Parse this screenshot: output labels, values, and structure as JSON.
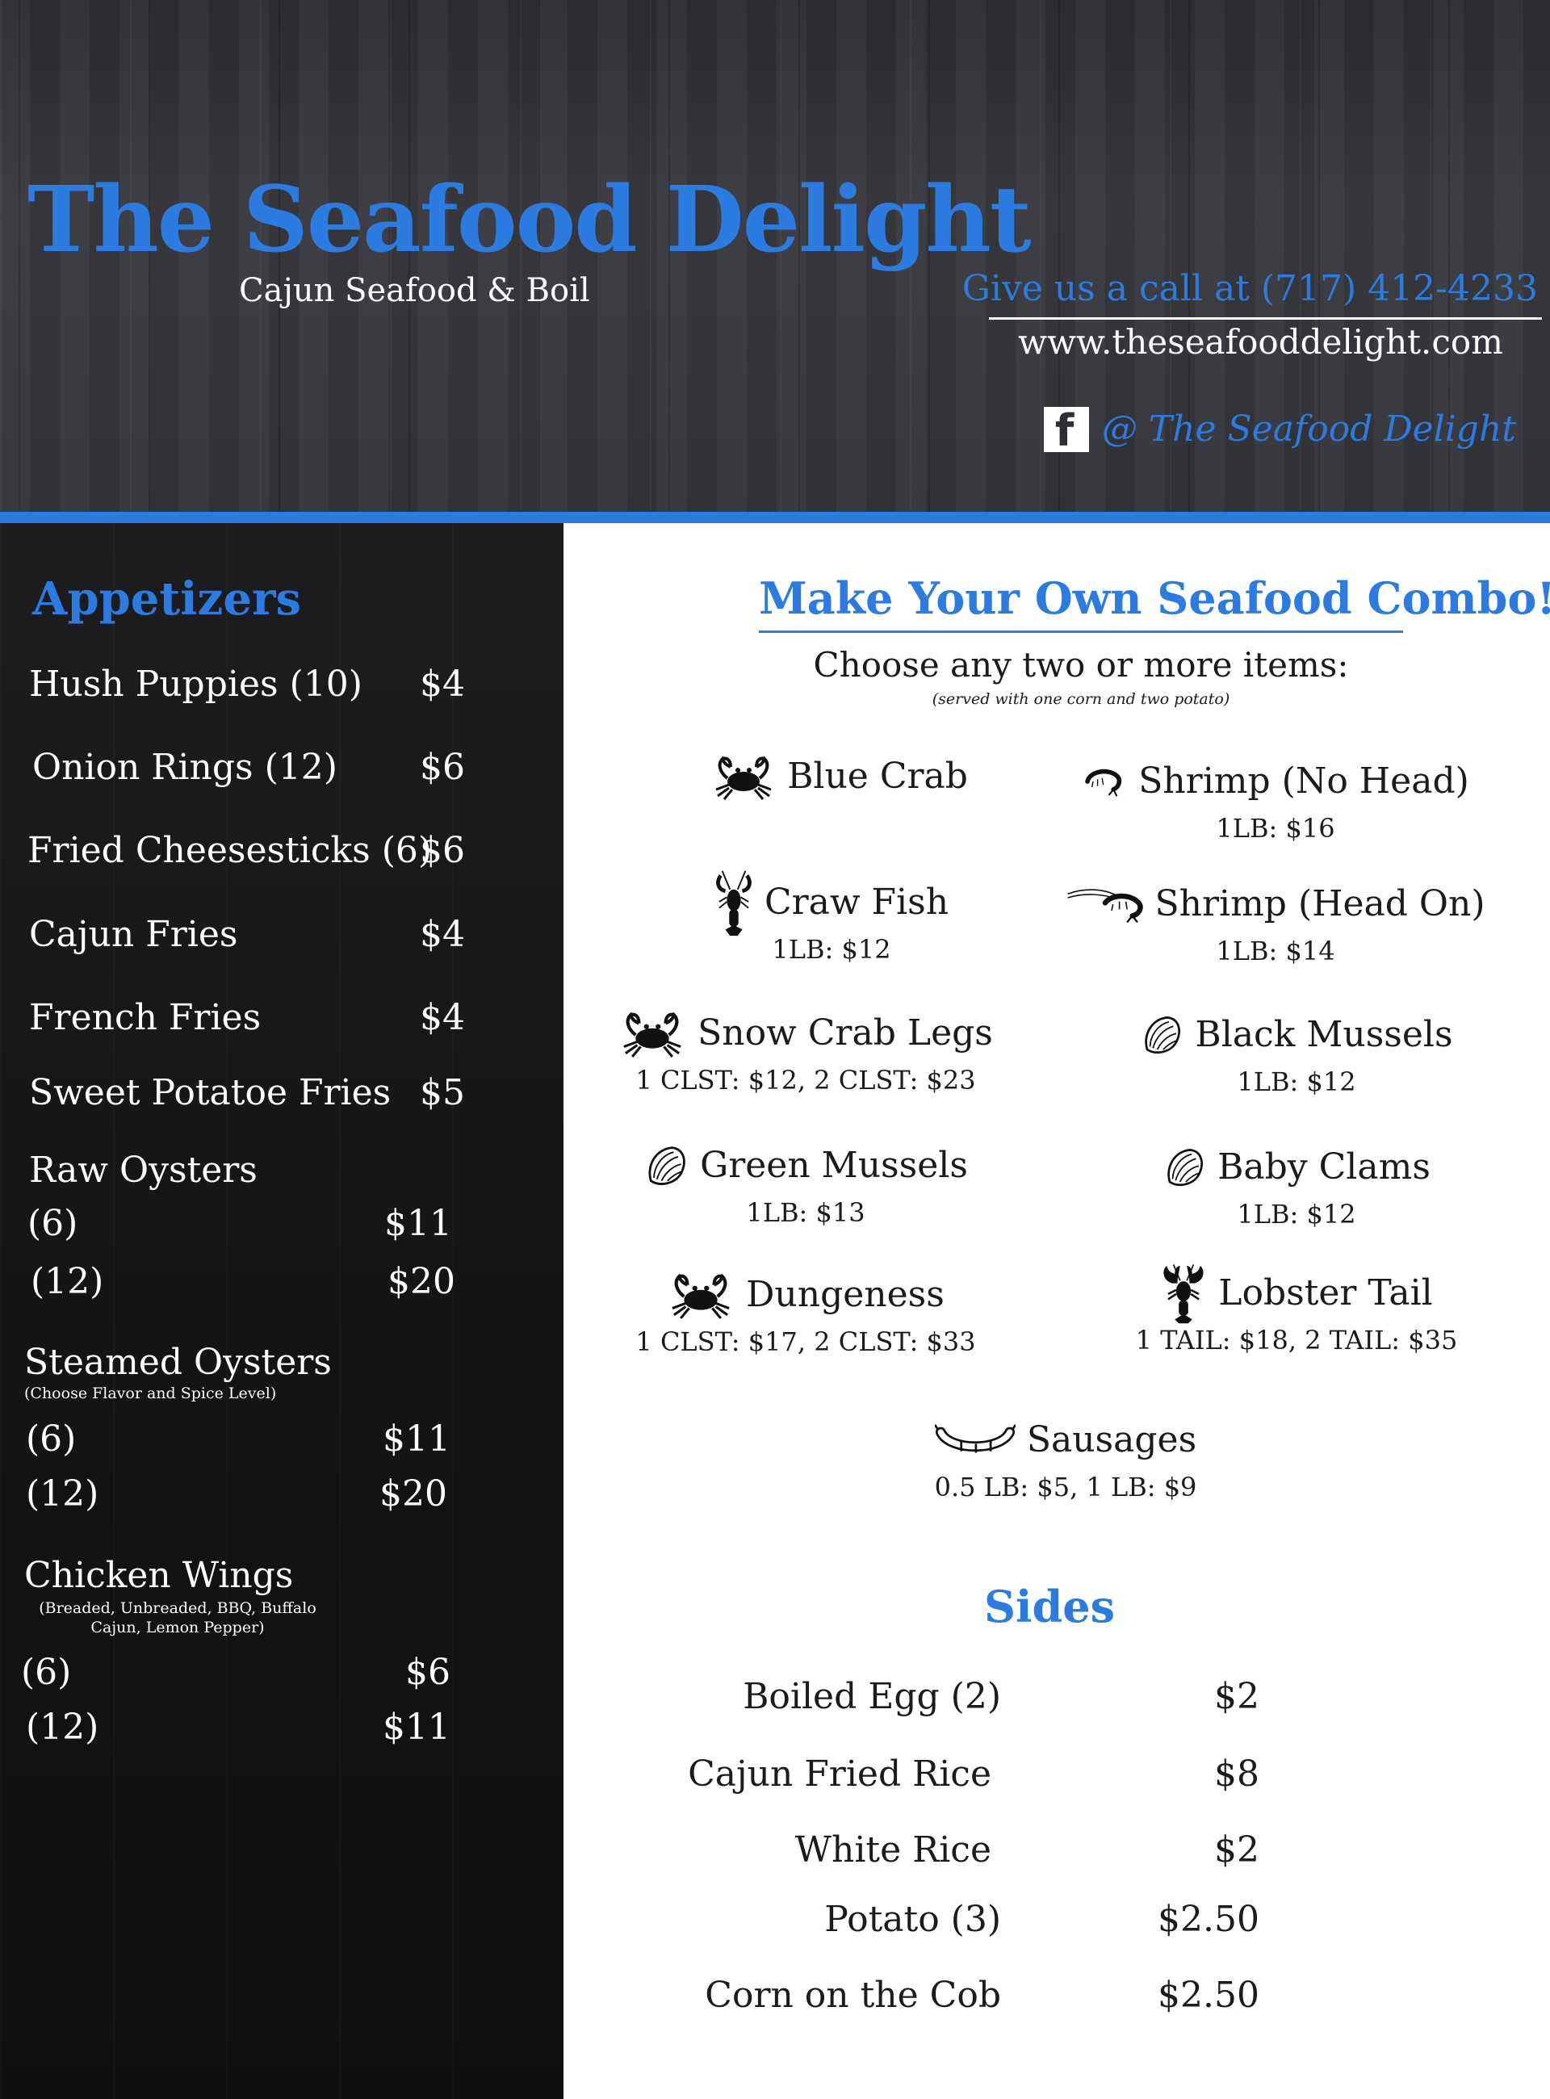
{
  "header": {
    "title": "The Seafood Delight",
    "subtitle": "Cajun Seafood & Boil",
    "phone_line": "Give us a call at (717) 412-4233",
    "website": "www.theseafooddelight.com",
    "facebook_letter": "f",
    "facebook_handle": "@ The Seafood Delight"
  },
  "appetizers": {
    "title": "Appetizers",
    "items": [
      {
        "name": "Hush Puppies (10)",
        "price": "$4"
      },
      {
        "name": "Onion Rings (12)",
        "price": "$6"
      },
      {
        "name": "Fried Cheesesticks (6)",
        "price": "$6"
      },
      {
        "name": "Cajun Fries",
        "price": "$4"
      },
      {
        "name": "French Fries",
        "price": "$4"
      },
      {
        "name": "Sweet Potatoe Fries",
        "price": "$5"
      }
    ],
    "raw_oysters": {
      "title": "Raw Oysters",
      "options": [
        {
          "qty": "(6)",
          "price": "$11"
        },
        {
          "qty": "(12)",
          "price": "$20"
        }
      ]
    },
    "steamed_oysters": {
      "title": "Steamed Oysters",
      "note": "(Choose Flavor and Spice Level)",
      "options": [
        {
          "qty": "(6)",
          "price": "$11"
        },
        {
          "qty": "(12)",
          "price": "$20"
        }
      ]
    },
    "chicken_wings": {
      "title": "Chicken Wings",
      "note": "(Breaded, Unbreaded, BBQ, Buffalo Cajun, Lemon Pepper)",
      "options": [
        {
          "qty": "(6)",
          "price": "$6"
        },
        {
          "qty": "(12)",
          "price": "$11"
        }
      ]
    }
  },
  "combo": {
    "title": "Make Your Own Seafood Combo!",
    "subtitle": "Choose any two or more items:",
    "note": "(served with one corn and two potato)",
    "items": [
      {
        "name": "Blue Crab",
        "price": "",
        "icon": "crab-icon"
      },
      {
        "name": "Shrimp (No Head)",
        "price": "1LB: $16",
        "icon": "shrimp-icon"
      },
      {
        "name": "Craw Fish",
        "price": "1LB: $12",
        "icon": "crawfish-icon"
      },
      {
        "name": "Shrimp (Head On)",
        "price": "1LB: $14",
        "icon": "shrimp-head-icon"
      },
      {
        "name": "Snow Crab Legs",
        "price": "1 CLST: $12,  2 CLST: $23",
        "icon": "crab-icon"
      },
      {
        "name": "Black Mussels",
        "price": "1LB: $12",
        "icon": "mussel-icon"
      },
      {
        "name": "Green Mussels",
        "price": "1LB: $13",
        "icon": "mussel-icon"
      },
      {
        "name": "Baby Clams",
        "price": "1LB: $12",
        "icon": "clam-icon"
      },
      {
        "name": "Dungeness",
        "price": "1 CLST: $17,  2 CLST: $33",
        "icon": "crab-icon"
      },
      {
        "name": "Lobster Tail",
        "price": "1 TAIL: $18,  2 TAIL: $35",
        "icon": "lobster-icon"
      },
      {
        "name": "Sausages",
        "price": "0.5 LB: $5,  1 LB: $9",
        "icon": "sausage-icon"
      }
    ]
  },
  "sides": {
    "title": "Sides",
    "items": [
      {
        "name": "Boiled Egg (2)",
        "price": "$2"
      },
      {
        "name": "Cajun Fried Rice",
        "price": "$8"
      },
      {
        "name": "White Rice",
        "price": "$2"
      },
      {
        "name": "Potato (3)",
        "price": "$2.50"
      },
      {
        "name": "Corn on the Cob",
        "price": "$2.50"
      }
    ]
  },
  "colors": {
    "brand_blue": "#2b7be0",
    "header_bg": "#35363b",
    "panel_bg": "#141415",
    "text_dark": "#1b1b1b"
  }
}
